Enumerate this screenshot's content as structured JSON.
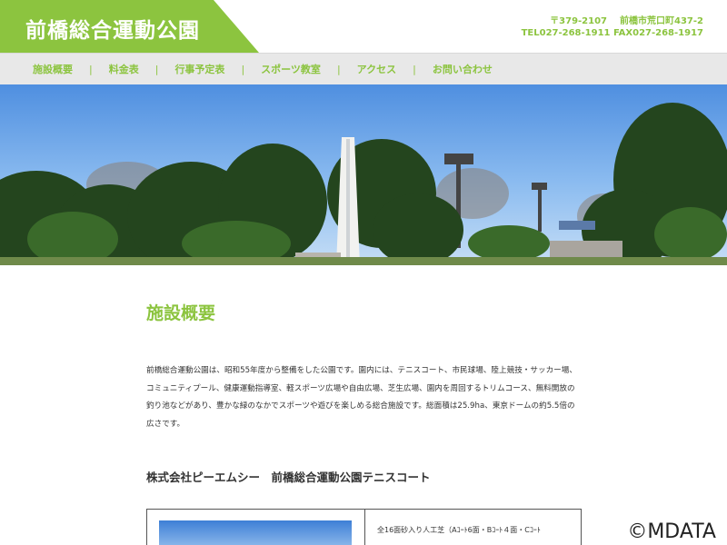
{
  "site": {
    "title": "前橋総合運動公園",
    "postal": "〒379-2107",
    "address": "前橋市荒口町437-2",
    "tel": "TEL027-268-1911",
    "fax": "FAX027-268-1917"
  },
  "nav": {
    "items": [
      {
        "label": "施設概要"
      },
      {
        "label": "料金表"
      },
      {
        "label": "行事予定表"
      },
      {
        "label": "スポーツ教室"
      },
      {
        "label": "アクセス"
      },
      {
        "label": "お問い合わせ"
      }
    ]
  },
  "main": {
    "section_title": "施設概要",
    "description": "前橋総合運動公園は、昭和55年度から整備をした公園です。園内には、テニスコート、市民球場、陸上競技・サッカー場、コミュニティプール、健康運動指導室、軽スポーツ広場や自由広場、芝生広場、園内を周回するトリムコース、無料開放の釣り池などがあり、豊かな緑のなかでスポーツや遊びを楽しめる総合施設です。総面積は25.9ha、東京ドームの約5.5倍の広さです。",
    "subheading": "株式会社ピーエムシー　前橋総合運動公園テニスコート",
    "card_text": "全16面砂入り人工芝（Aｺｰﾄ6面・Bｺｰﾄ４面・Cｺｰﾄ"
  },
  "watermark": "©MDATA",
  "colors": {
    "accent": "#8cc43f",
    "nav_bg": "#e8e8e8"
  }
}
